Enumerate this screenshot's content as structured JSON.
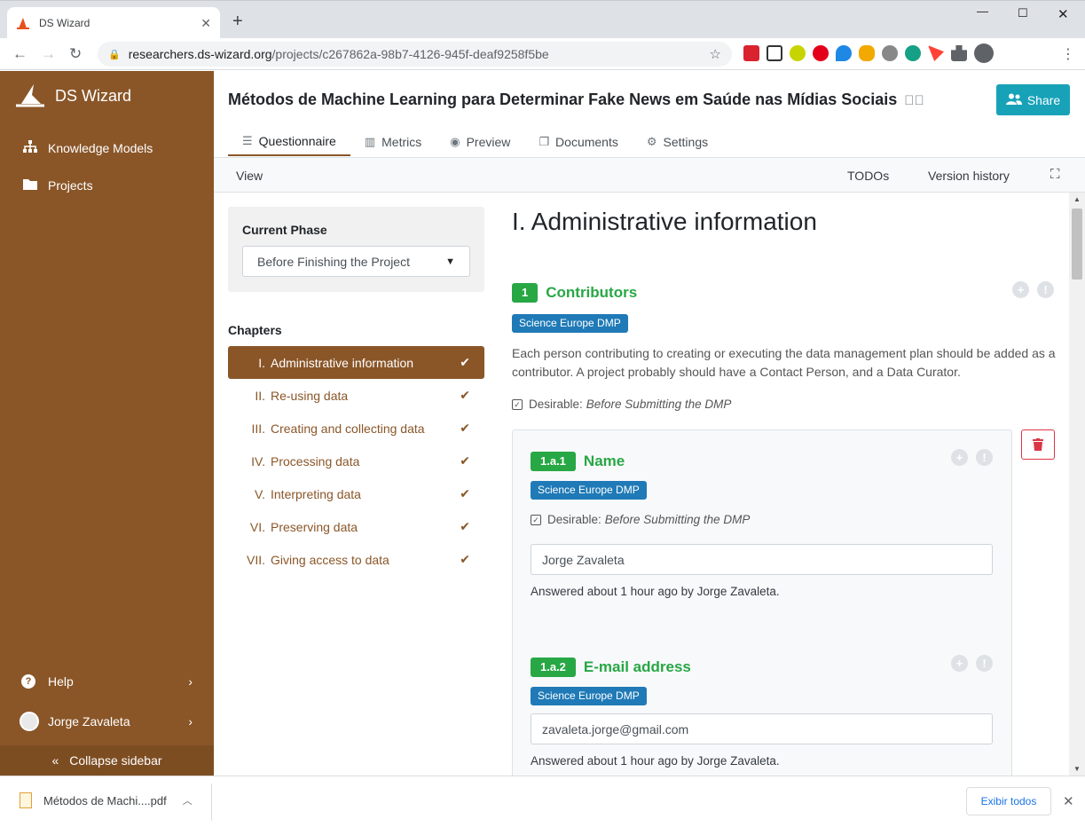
{
  "browser": {
    "tab_title": "DS Wizard",
    "tab_close": "✕",
    "new_tab": "+",
    "url_host": "researchers.ds-wizard.org",
    "url_path": "/projects/c267862a-98b7-4126-945f-deaf9258f5be"
  },
  "sidebar": {
    "app_name": "DS Wizard",
    "items": [
      {
        "label": "Knowledge Models",
        "icon": "sitemap-icon"
      },
      {
        "label": "Projects",
        "icon": "folder-icon"
      }
    ],
    "help_label": "Help",
    "user_name": "Jorge Zavaleta",
    "collapse_label": "Collapse sidebar"
  },
  "project": {
    "title": "Métodos de Machine Learning para Determinar Fake News em Saúde nas Mídias Sociais",
    "share_label": "Share",
    "tabs": [
      {
        "label": "Questionnaire",
        "icon": "list-icon"
      },
      {
        "label": "Metrics",
        "icon": "bar-chart-icon"
      },
      {
        "label": "Preview",
        "icon": "eye-icon"
      },
      {
        "label": "Documents",
        "icon": "copy-icon"
      },
      {
        "label": "Settings",
        "icon": "cogs-icon"
      }
    ]
  },
  "toolbar": {
    "view": "View",
    "todos": "TODOs",
    "version_history": "Version history"
  },
  "phase": {
    "label": "Current Phase",
    "selected": "Before Finishing the Project"
  },
  "chapters": {
    "heading": "Chapters",
    "items": [
      {
        "num": "I.",
        "label": "Administrative information"
      },
      {
        "num": "II.",
        "label": "Re-using data"
      },
      {
        "num": "III.",
        "label": "Creating and collecting data"
      },
      {
        "num": "IV.",
        "label": "Processing data"
      },
      {
        "num": "V.",
        "label": "Interpreting data"
      },
      {
        "num": "VI.",
        "label": "Preserving data"
      },
      {
        "num": "VII.",
        "label": "Giving access to data"
      }
    ]
  },
  "content": {
    "chapter_title": "I. Administrative information",
    "q1": {
      "num": "1",
      "title": "Contributors",
      "tag": "Science Europe DMP",
      "description": "Each person contributing to creating or executing the data management plan should be added as a contributor. A project probably should have a Contact Person, and a Data Curator.",
      "desirable_label": "Desirable:",
      "desirable_phase": "Before Submitting the DMP"
    },
    "q1a1": {
      "num": "1.a.1",
      "title": "Name",
      "tag": "Science Europe DMP",
      "desirable_label": "Desirable:",
      "desirable_phase": "Before Submitting the DMP",
      "value": "Jorge Zavaleta",
      "answered": "Answered about 1 hour ago by Jorge Zavaleta."
    },
    "q1a2": {
      "num": "1.a.2",
      "title": "E-mail address",
      "tag": "Science Europe DMP",
      "value": "zavaleta.jorge@gmail.com",
      "answered": "Answered about 1 hour ago by Jorge Zavaleta."
    }
  },
  "downloads": {
    "file": "Métodos de Machi....pdf",
    "show_all": "Exibir todos"
  }
}
